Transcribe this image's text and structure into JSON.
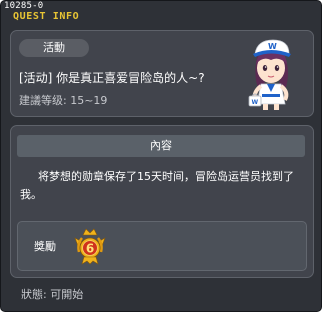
{
  "window": {
    "quest_id": "10285-0",
    "title": "QUEST INFO"
  },
  "quest": {
    "tag": "活動",
    "name": "[活动]  你是真正喜爱冒险岛的人~?",
    "level": "建議等级: 15~19"
  },
  "content": {
    "header": "內容",
    "description": "将梦想的勋章保存了15天时间，冒险岛运营员找到了我。"
  },
  "reward": {
    "label": "獎勵",
    "medal_number": "6"
  },
  "status": {
    "text": "狀態:  可開始"
  },
  "colors": {
    "title_accent": "#e8c534",
    "window_bg": "#2e3137",
    "panel_bg": "#41444c",
    "medal_gold": "#f0b21c",
    "medal_red": "#d0321c"
  }
}
